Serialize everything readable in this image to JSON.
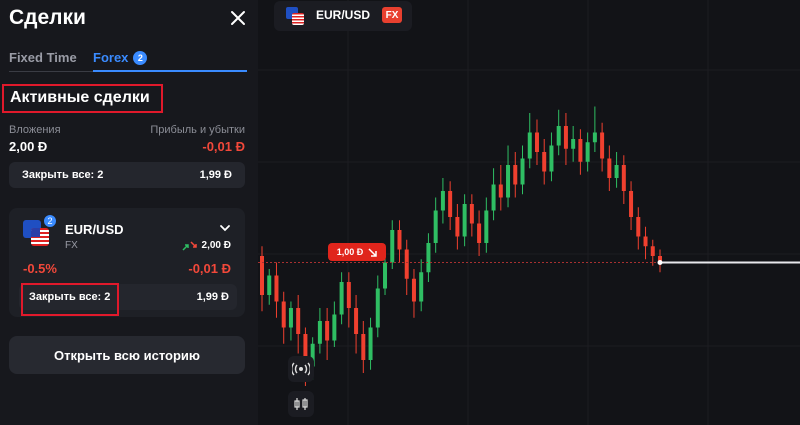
{
  "panel": {
    "title": "Сделки",
    "tabs": [
      {
        "label": "Fixed Time"
      },
      {
        "label": "Forex",
        "badge": "2"
      }
    ],
    "active_title": "Активные сделки",
    "investments_label": "Вложения",
    "investments_value": "2,00 Đ",
    "pnl_label": "Прибыль и убытки",
    "pnl_value": "-0,01 Đ",
    "close_all_label": "Закрыть все: 2",
    "close_all_value": "1,99 Đ",
    "deal": {
      "badge": "2",
      "pair": "EUR/USD",
      "market": "FX",
      "amount": "2,00 Đ",
      "percent": "-0.5%",
      "pnl": "-0,01 Đ",
      "close_label": "Закрыть все: 2",
      "close_value": "1,99 Đ"
    },
    "history_button": "Открыть всю историю"
  },
  "chart_header": {
    "pair": "EUR/USD",
    "market_badge": "FX"
  },
  "chart": {
    "price_tag": "1,00 Đ"
  },
  "colors": {
    "accent": "#3a8bff",
    "negative": "#f2483a",
    "highlight_outline": "#e0192b",
    "candle_up": "#2fbe63",
    "candle_down": "#f0402f"
  },
  "chart_data": {
    "type": "candlestick",
    "candles": [
      {
        "o": 0.52,
        "c": 0.4,
        "h": 0.55,
        "l": 0.35
      },
      {
        "o": 0.4,
        "c": 0.46,
        "h": 0.48,
        "l": 0.37
      },
      {
        "o": 0.46,
        "c": 0.38,
        "h": 0.5,
        "l": 0.33
      },
      {
        "o": 0.38,
        "c": 0.3,
        "h": 0.41,
        "l": 0.25
      },
      {
        "o": 0.3,
        "c": 0.36,
        "h": 0.38,
        "l": 0.26
      },
      {
        "o": 0.36,
        "c": 0.28,
        "h": 0.4,
        "l": 0.22
      },
      {
        "o": 0.28,
        "c": 0.18,
        "h": 0.3,
        "l": 0.12
      },
      {
        "o": 0.18,
        "c": 0.25,
        "h": 0.27,
        "l": 0.14
      },
      {
        "o": 0.25,
        "c": 0.32,
        "h": 0.36,
        "l": 0.22
      },
      {
        "o": 0.32,
        "c": 0.26,
        "h": 0.36,
        "l": 0.2
      },
      {
        "o": 0.26,
        "c": 0.34,
        "h": 0.38,
        "l": 0.24
      },
      {
        "o": 0.34,
        "c": 0.44,
        "h": 0.47,
        "l": 0.31
      },
      {
        "o": 0.44,
        "c": 0.36,
        "h": 0.47,
        "l": 0.3
      },
      {
        "o": 0.36,
        "c": 0.28,
        "h": 0.4,
        "l": 0.22
      },
      {
        "o": 0.28,
        "c": 0.2,
        "h": 0.32,
        "l": 0.16
      },
      {
        "o": 0.2,
        "c": 0.3,
        "h": 0.33,
        "l": 0.17
      },
      {
        "o": 0.3,
        "c": 0.42,
        "h": 0.46,
        "l": 0.27
      },
      {
        "o": 0.42,
        "c": 0.5,
        "h": 0.54,
        "l": 0.4
      },
      {
        "o": 0.5,
        "c": 0.6,
        "h": 0.63,
        "l": 0.48
      },
      {
        "o": 0.6,
        "c": 0.54,
        "h": 0.63,
        "l": 0.5
      },
      {
        "o": 0.54,
        "c": 0.45,
        "h": 0.57,
        "l": 0.4
      },
      {
        "o": 0.45,
        "c": 0.38,
        "h": 0.48,
        "l": 0.33
      },
      {
        "o": 0.38,
        "c": 0.47,
        "h": 0.51,
        "l": 0.35
      },
      {
        "o": 0.47,
        "c": 0.56,
        "h": 0.59,
        "l": 0.44
      },
      {
        "o": 0.56,
        "c": 0.66,
        "h": 0.7,
        "l": 0.53
      },
      {
        "o": 0.66,
        "c": 0.72,
        "h": 0.76,
        "l": 0.62
      },
      {
        "o": 0.72,
        "c": 0.64,
        "h": 0.75,
        "l": 0.6
      },
      {
        "o": 0.64,
        "c": 0.58,
        "h": 0.68,
        "l": 0.54
      },
      {
        "o": 0.58,
        "c": 0.68,
        "h": 0.71,
        "l": 0.55
      },
      {
        "o": 0.68,
        "c": 0.62,
        "h": 0.71,
        "l": 0.58
      },
      {
        "o": 0.62,
        "c": 0.56,
        "h": 0.66,
        "l": 0.52
      },
      {
        "o": 0.56,
        "c": 0.66,
        "h": 0.7,
        "l": 0.53
      },
      {
        "o": 0.66,
        "c": 0.74,
        "h": 0.79,
        "l": 0.63
      },
      {
        "o": 0.74,
        "c": 0.7,
        "h": 0.8,
        "l": 0.66
      },
      {
        "o": 0.7,
        "c": 0.8,
        "h": 0.86,
        "l": 0.67
      },
      {
        "o": 0.8,
        "c": 0.74,
        "h": 0.84,
        "l": 0.7
      },
      {
        "o": 0.74,
        "c": 0.82,
        "h": 0.86,
        "l": 0.71
      },
      {
        "o": 0.82,
        "c": 0.9,
        "h": 0.96,
        "l": 0.79
      },
      {
        "o": 0.9,
        "c": 0.84,
        "h": 0.94,
        "l": 0.8
      },
      {
        "o": 0.84,
        "c": 0.78,
        "h": 0.88,
        "l": 0.74
      },
      {
        "o": 0.78,
        "c": 0.86,
        "h": 0.9,
        "l": 0.75
      },
      {
        "o": 0.86,
        "c": 0.92,
        "h": 0.97,
        "l": 0.83
      },
      {
        "o": 0.92,
        "c": 0.85,
        "h": 0.96,
        "l": 0.8
      },
      {
        "o": 0.85,
        "c": 0.88,
        "h": 0.92,
        "l": 0.81
      },
      {
        "o": 0.88,
        "c": 0.81,
        "h": 0.91,
        "l": 0.77
      },
      {
        "o": 0.81,
        "c": 0.87,
        "h": 0.9,
        "l": 0.78
      },
      {
        "o": 0.87,
        "c": 0.9,
        "h": 0.98,
        "l": 0.84
      },
      {
        "o": 0.9,
        "c": 0.82,
        "h": 0.93,
        "l": 0.78
      },
      {
        "o": 0.82,
        "c": 0.76,
        "h": 0.86,
        "l": 0.72
      },
      {
        "o": 0.76,
        "c": 0.8,
        "h": 0.84,
        "l": 0.73
      },
      {
        "o": 0.8,
        "c": 0.72,
        "h": 0.83,
        "l": 0.68
      },
      {
        "o": 0.72,
        "c": 0.64,
        "h": 0.75,
        "l": 0.6
      },
      {
        "o": 0.64,
        "c": 0.58,
        "h": 0.67,
        "l": 0.54
      },
      {
        "o": 0.58,
        "c": 0.55,
        "h": 0.61,
        "l": 0.51
      },
      {
        "o": 0.55,
        "c": 0.52,
        "h": 0.57,
        "l": 0.49
      },
      {
        "o": 0.52,
        "c": 0.5,
        "h": 0.54,
        "l": 0.47
      }
    ],
    "current_level": 0.5
  }
}
